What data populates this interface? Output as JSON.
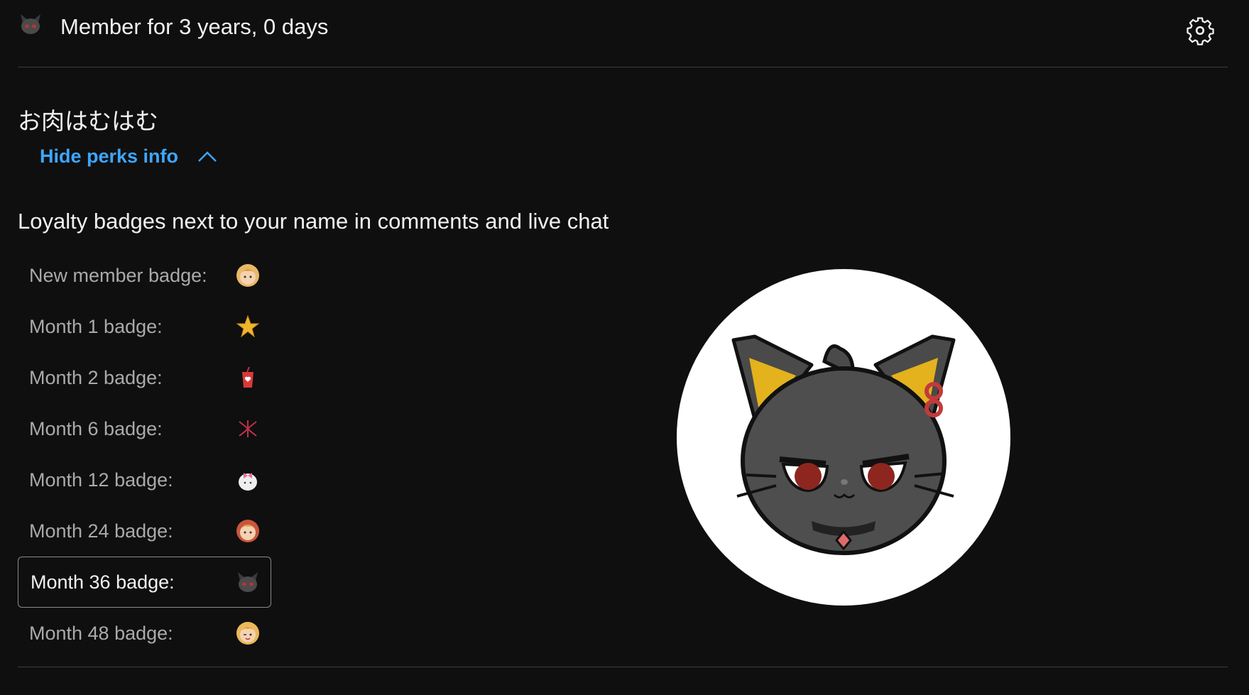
{
  "header": {
    "membership_duration": "Member for 3 years, 0 days",
    "avatar_icon": "cat-face-icon",
    "settings_icon": "gear-icon"
  },
  "tier": {
    "name": "お肉はむはむ"
  },
  "perks": {
    "toggle_label": "Hide perks info",
    "toggle_icon": "chevron-up-icon",
    "title": "Loyalty badges next to your name in comments and live chat",
    "badges": [
      {
        "label": "New member badge:",
        "icon": "blonde-face-icon",
        "selected": false
      },
      {
        "label": "Month 1 badge:",
        "icon": "gold-star-icon",
        "selected": false
      },
      {
        "label": "Month 2 badge:",
        "icon": "red-cup-heart-icon",
        "selected": false
      },
      {
        "label": "Month 6 badge:",
        "icon": "red-spark-icon",
        "selected": false
      },
      {
        "label": "Month 12 badge:",
        "icon": "white-blob-bow-icon",
        "selected": false
      },
      {
        "label": "Month 24 badge:",
        "icon": "redhead-face-icon",
        "selected": false
      },
      {
        "label": "Month 36 badge:",
        "icon": "black-cat-icon",
        "selected": true
      },
      {
        "label": "Month 48 badge:",
        "icon": "winking-blonde-face-icon",
        "selected": false
      }
    ],
    "preview_icon": "black-cat-large-icon"
  },
  "colors": {
    "background": "#0f0f0f",
    "accent_link": "#3ea6ff",
    "muted_text": "#aaaaaa",
    "primary_text": "#f1f1f1"
  }
}
